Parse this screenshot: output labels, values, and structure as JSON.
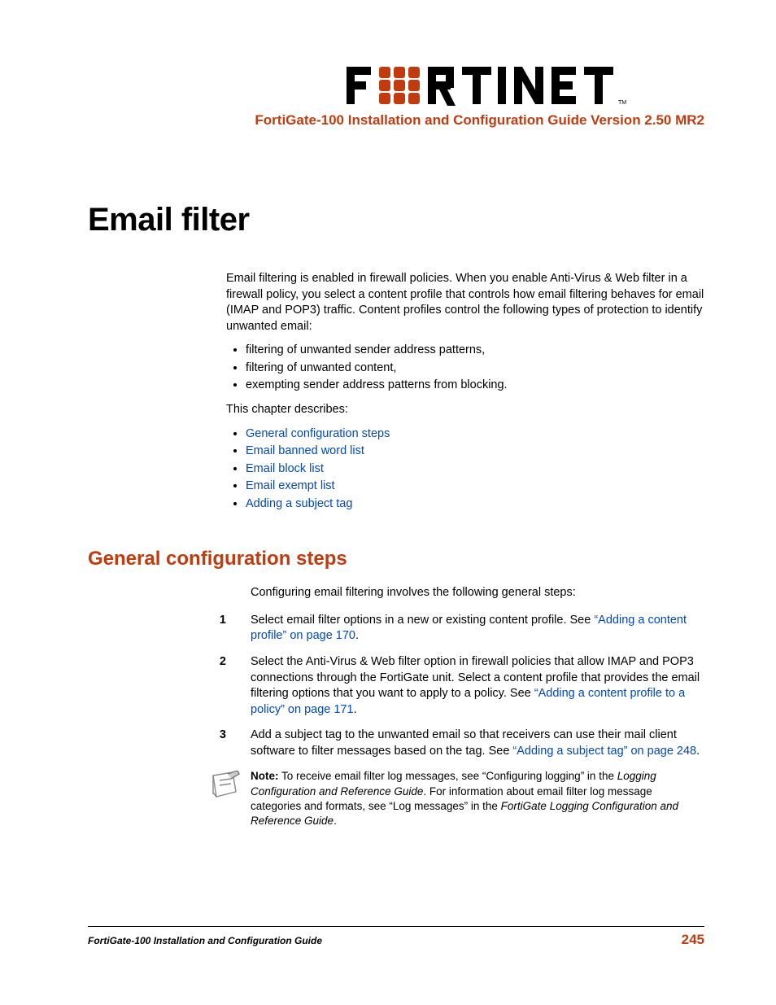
{
  "header": {
    "brand": "FORTINET",
    "doc_title": "FortiGate-100 Installation and Configuration Guide Version 2.50 MR2"
  },
  "chapter": {
    "title": "Email filter",
    "intro": "Email filtering is enabled in firewall policies. When you enable Anti-Virus & Web filter in a firewall policy, you select a content profile that controls how email filtering behaves for email (IMAP and POP3) traffic. Content profiles control the following types of protection to identify unwanted email:",
    "bullets": [
      "filtering of unwanted sender address patterns,",
      "filtering of unwanted content,",
      "exempting sender address patterns from blocking."
    ],
    "describes_label": "This chapter describes:",
    "toc": [
      "General configuration steps",
      "Email banned word list",
      "Email block list",
      "Email exempt list",
      "Adding a subject tag"
    ]
  },
  "section": {
    "heading": "General configuration steps",
    "intro": "Configuring email filtering involves the following general steps:",
    "steps": [
      {
        "n": "1",
        "pre": "Select email filter options in a new or existing content profile. See ",
        "link": "“Adding a content profile” on page 170",
        "post": "."
      },
      {
        "n": "2",
        "pre": "Select the Anti-Virus & Web filter option in firewall policies that allow IMAP and POP3 connections through the FortiGate unit. Select a content profile that provides the email filtering options that you want to apply to a policy. See ",
        "link": "“Adding a content profile to a policy” on page 171",
        "post": "."
      },
      {
        "n": "3",
        "pre": "Add a subject tag to the unwanted email so that receivers can use their mail client software to filter messages based on the tag. See ",
        "link": "“Adding a subject tag” on page 248",
        "post": "."
      }
    ],
    "note": {
      "label": "Note:",
      "t1": " To receive email filter log messages, see “Configuring logging” in the ",
      "i1": "Logging Configuration and Reference Guide",
      "t2": ". For information about email filter log message categories and formats, see “Log messages” in the ",
      "i2": "FortiGate Logging Configuration and Reference Guide",
      "t3": "."
    }
  },
  "footer": {
    "title": "FortiGate-100 Installation and Configuration Guide",
    "page": "245"
  }
}
